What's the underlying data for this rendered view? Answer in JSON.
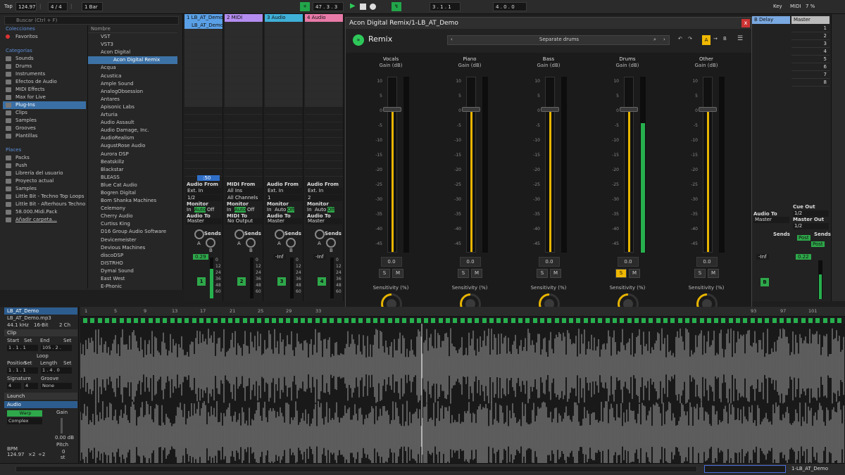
{
  "transport": {
    "tap": "Tap",
    "bpm": "124.97",
    "sig": "4 / 4",
    "sig_sep": "|",
    "sig_sep2": "|",
    "quant": "1 Bar",
    "arr_pos": "47 .  3 .  3",
    "loop_start": "3 .  1 .  1",
    "loop_len": "4 .  0 .  0",
    "key": "Key",
    "midi": "MIDI",
    "cpu": "7 %"
  },
  "browser": {
    "search_placeholder": "Buscar (Ctrl + F)",
    "collections_header": "Colecciones",
    "favorites": "Favoritos",
    "categories_header": "Categorías",
    "categories": [
      "Sounds",
      "Drums",
      "Instruments",
      "Efectos de Audio",
      "MIDI Effects",
      "Max for Live",
      "Plug-Ins",
      "Clips",
      "Samples",
      "Grooves",
      "Plantillas"
    ],
    "selected_category": "Plug-Ins",
    "places_header": "Places",
    "places": [
      "Packs",
      "Push",
      "Librería del usuario",
      "Proyecto actual",
      "Samples",
      "Little Bit - Techno Top Loops",
      "Little Bit - Afterhours Techno",
      "58.000.Midi.Pack",
      "Añadir carpeta…"
    ],
    "name_header": "Nombre",
    "items": [
      "VST",
      "VST3",
      "Acon Digital",
      "Acon Digital Remix",
      "Acqua",
      "Acustica",
      "Ample Sound",
      "AnalogObsession",
      "Antares",
      "Apisonic Labs",
      "Arturia",
      "Audio Assault",
      "Audio Damage, Inc.",
      "AudioRealism",
      "AugustRose Audio",
      "Aurora DSP",
      "Beatskillz",
      "Blackstar",
      "BLEASS",
      "Blue Cat Audio",
      "Bogren Digital",
      "Bom Shanka Machines",
      "Celemony",
      "Cherry Audio",
      "Curtiss King",
      "D16 Group Audio Software",
      "Devicemeister",
      "Devious Machines",
      "discoDSP",
      "DISTRHO",
      "Dymai Sound",
      "East West",
      "E-Phonic"
    ]
  },
  "tracks": [
    {
      "name": "1 LB_AT_Demo",
      "color": "#5aa0e6",
      "clip": "LB_AT_Demo",
      "io_from": "Ext. In",
      "io_ch": "1/2",
      "io_to": "Master",
      "monitor": "Auto",
      "vol": "0.29",
      "num": "1",
      "input_label": "Audio From",
      "output_label": "Audio To"
    },
    {
      "name": "2 MIDI",
      "color": "#b48cf0",
      "io_from": "All Ins",
      "io_ch": "All Channels",
      "io_to": "No Output",
      "monitor": "Auto",
      "vol": "",
      "num": "2",
      "input_label": "MIDI From",
      "output_label": "MIDI To"
    },
    {
      "name": "3 Audio",
      "color": "#3fb0d8",
      "io_from": "Ext. In",
      "io_ch": "1",
      "io_to": "Master",
      "monitor": "Off",
      "vol": "-Inf",
      "num": "3",
      "input_label": "Audio From",
      "output_label": "Audio To"
    },
    {
      "name": "4 Audio",
      "color": "#e87aa8",
      "io_from": "Ext. In",
      "io_ch": "2",
      "io_to": "Master",
      "monitor": "Off",
      "vol": "-Inf",
      "num": "4",
      "input_label": "Audio From",
      "output_label": "Audio To"
    }
  ],
  "mixer_labels": {
    "monitor": "Monitor",
    "in": "In",
    "auto": "Auto",
    "off": "Off",
    "sends": "Sends",
    "send_a": "A",
    "send_b": "B",
    "scale": [
      "0",
      "12",
      "24",
      "36",
      "48",
      "60"
    ],
    "scene_counter": ":50"
  },
  "right_mixer": {
    "delay": "B Delay",
    "master": "Master",
    "cue_out": "Cue Out",
    "cue_ch": "1/2",
    "master_out": "Master Out",
    "master_ch": "1/2",
    "audio_to": "Audio To",
    "master_to": "Master",
    "sends": "Sends",
    "post": "Post",
    "vol_a": "-Inf",
    "vol_master": "0.22",
    "slots": [
      "1",
      "2",
      "3",
      "4",
      "5",
      "6",
      "7",
      "8"
    ],
    "send_label": "B"
  },
  "plugin": {
    "title": "Acon Digital Remix/1-LB_AT_Demo",
    "close": "x",
    "brand": "Remix",
    "preset": "Separate drums",
    "scale": [
      "10",
      "5",
      "0",
      "-5",
      "-10",
      "-15",
      "-20",
      "-25",
      "-30",
      "-35",
      "-40",
      "-45"
    ],
    "stems": [
      {
        "name": "Vocals",
        "gain_label": "Gain (dB)",
        "gain": "0.0",
        "solo": false,
        "sens_label": "Sensitivity (%)",
        "sens": "0.0",
        "level": 0.0
      },
      {
        "name": "Piano",
        "gain_label": "Gain (dB)",
        "gain": "0.0",
        "solo": false,
        "sens_label": "Sensitivity (%)",
        "sens": "0.0",
        "level": 0.0
      },
      {
        "name": "Bass",
        "gain_label": "Gain (dB)",
        "gain": "0.0",
        "solo": false,
        "sens_label": "Sensitivity (%)",
        "sens": "0.0",
        "level": 0.0
      },
      {
        "name": "Drums",
        "gain_label": "Gain (dB)",
        "gain": "0.0",
        "solo": true,
        "sens_label": "Sensitivity (%)",
        "sens": "0.0",
        "level": 0.82
      },
      {
        "name": "Other",
        "gain_label": "Gain (dB)",
        "gain": "0.0",
        "solo": false,
        "sens_label": "Sensitivity (%)",
        "sens": "0.0",
        "level": 0.0
      }
    ],
    "s": "S",
    "m": "M",
    "a": "A"
  },
  "clip": {
    "name": "LB_AT_Demo",
    "file": "LB_AT_Demo.mp3",
    "rate": "44.1 kHz",
    "bits": "16-Bit",
    "ch": "2 Ch",
    "clip_label": "Clip",
    "start": "Start",
    "set": "Set",
    "end": "End",
    "start_val": "1 .  1 .  1",
    "end_val": "105 .  2 .",
    "loop": "Loop",
    "position": "Position",
    "length": "Length",
    "pos_val": "1 .  1 .  1",
    "len_val": "1 .  4 .  0",
    "signature": "Signature",
    "groove": "Groove",
    "sig_num": "4",
    "sig_den": "4",
    "groove_val": "None",
    "launch": "Launch",
    "audio": "Audio",
    "warp": "Warp",
    "mode": "Complex",
    "gain": "Gain",
    "gain_val": "0.00 dB",
    "pitch": "Pitch",
    "semis": "0",
    "st": "st",
    "bpm": "BPM",
    "bpm_val": "124.97",
    "x2": "×2",
    "half": "÷2"
  },
  "ruler": [
    "1",
    "5",
    "9",
    "13",
    "17",
    "21",
    "25",
    "29",
    "33",
    "93",
    "97",
    "101"
  ],
  "status": {
    "track": "1-LB_AT_Demo"
  }
}
